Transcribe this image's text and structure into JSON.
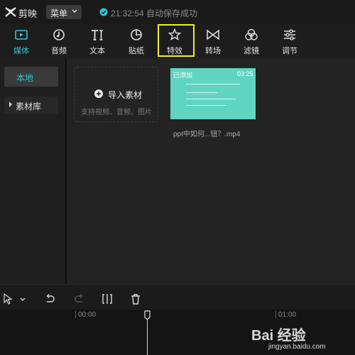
{
  "titlebar": {
    "app_name": "剪映",
    "menu_label": "菜单",
    "save_status": "21:32:54 自动保存成功"
  },
  "toolbar": {
    "items": [
      {
        "label": "媒体",
        "icon": "media-icon",
        "active": true
      },
      {
        "label": "音频",
        "icon": "audio-icon"
      },
      {
        "label": "文本",
        "icon": "text-icon"
      },
      {
        "label": "贴纸",
        "icon": "sticker-icon"
      },
      {
        "label": "特效",
        "icon": "effects-icon",
        "highlighted": true
      },
      {
        "label": "转场",
        "icon": "transition-icon"
      },
      {
        "label": "滤镜",
        "icon": "filter-icon"
      },
      {
        "label": "调节",
        "icon": "adjust-icon"
      }
    ],
    "active_color": "#2fc5d1",
    "highlight_color": "#f2ee2a"
  },
  "sidebar": {
    "items": [
      {
        "label": "本地",
        "active": true
      },
      {
        "label": "素材库"
      }
    ]
  },
  "media": {
    "import_label": "导入素材",
    "import_hint": "支持视频、音频、图片",
    "clip": {
      "badge": "已添加",
      "duration": "03:25",
      "filename": "ppt中如何...钮？.mp4",
      "thumbnail_color": "#5fd5c1"
    }
  },
  "timeline": {
    "ticks": [
      "00:00",
      "01:00"
    ]
  },
  "watermark": {
    "brand": "Bai 经验",
    "url": "jingyan.baidu.com"
  }
}
